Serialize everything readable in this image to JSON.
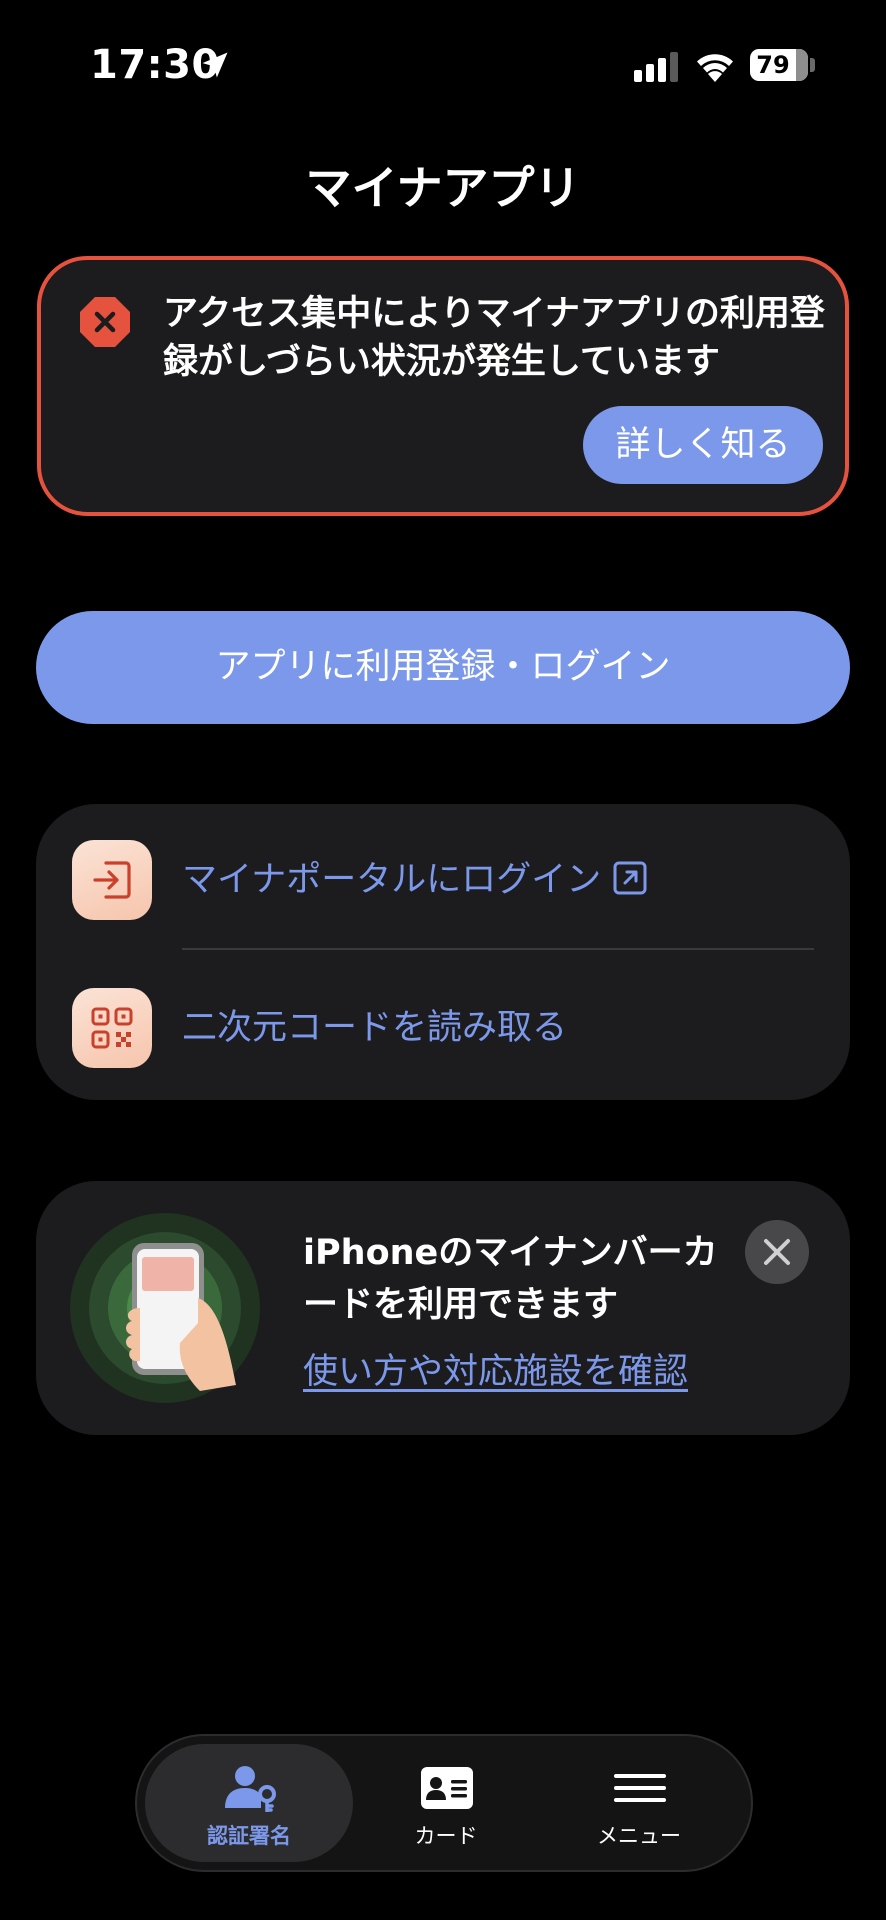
{
  "status_bar": {
    "time": "17:30",
    "battery": "79"
  },
  "header": {
    "title": "マイナアプリ"
  },
  "alert": {
    "message": "アクセス集中によりマイナアプリの利用登録がしづらい状況が発生しています",
    "button_label": "詳しく知る",
    "accent_color": "#e5533f"
  },
  "primary_button": {
    "label": "アプリに利用登録・ログイン",
    "color": "#7b98ea"
  },
  "actions": [
    {
      "label": "マイナポータルにログイン",
      "icon": "login-icon",
      "external": true
    },
    {
      "label": "二次元コードを読み取る",
      "icon": "qr-code-icon",
      "external": false
    }
  ],
  "promo": {
    "title": "iPhoneのマイナンバーカードを利用できます",
    "link_label": "使い方や対応施設を確認"
  },
  "tab_bar": {
    "tabs": [
      {
        "label": "認証署名",
        "icon": "user-key-icon",
        "selected": true
      },
      {
        "label": "カード",
        "icon": "id-card-icon",
        "selected": false
      },
      {
        "label": "メニュー",
        "icon": "menu-icon",
        "selected": false
      }
    ]
  }
}
